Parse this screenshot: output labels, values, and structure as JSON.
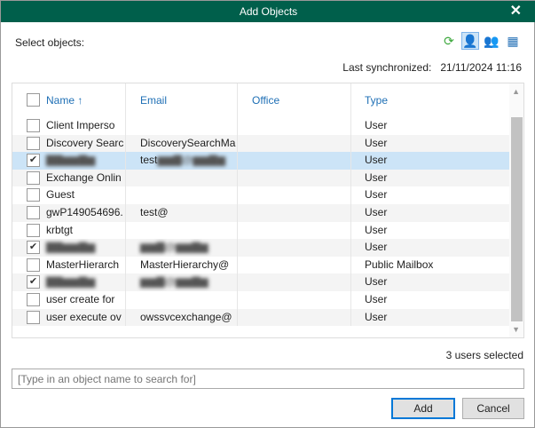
{
  "title": "Add Objects",
  "select_label": "Select objects:",
  "toolbar": {
    "icons": [
      "refresh-icon",
      "user-icon",
      "group-icon",
      "building-icon"
    ]
  },
  "sync": {
    "label": "Last synchronized:",
    "value": "21/11/2024 11:16"
  },
  "columns": [
    "Name ↑",
    "Email",
    "Office",
    "Type"
  ],
  "rows": [
    {
      "name": "Client Imperso",
      "email": "",
      "office": "",
      "type": "User",
      "checked": false
    },
    {
      "name": "Discovery Searc",
      "email": "DiscoverySearchMa",
      "office": "",
      "type": "User",
      "checked": false
    },
    {
      "name": "",
      "email": "test",
      "office": "",
      "type": "User",
      "checked": true,
      "highlight": true,
      "blurred": true
    },
    {
      "name": "Exchange Onlin",
      "email": "",
      "office": "",
      "type": "User",
      "checked": false
    },
    {
      "name": "Guest",
      "email": "",
      "office": "",
      "type": "User",
      "checked": false
    },
    {
      "name": "gwP149054696.",
      "email": "test@",
      "office": "",
      "type": "User",
      "checked": false
    },
    {
      "name": "krbtgt",
      "email": "",
      "office": "",
      "type": "User",
      "checked": false
    },
    {
      "name": "",
      "email": "",
      "office": "",
      "type": "User",
      "checked": true,
      "blurred": true
    },
    {
      "name": "MasterHierarch",
      "email": "MasterHierarchy@",
      "office": "",
      "type": "Public Mailbox",
      "checked": false
    },
    {
      "name": "",
      "email": "",
      "office": "",
      "type": "User",
      "checked": true,
      "blurred": true
    },
    {
      "name": "user create for",
      "email": "",
      "office": "",
      "type": "User",
      "checked": false
    },
    {
      "name": "user execute ov",
      "email": "owssvcexchange@",
      "office": "",
      "type": "User",
      "checked": false
    }
  ],
  "selected_count": "3 users selected",
  "search": {
    "placeholder": "[Type in an object name to search for]",
    "value": ""
  },
  "buttons": {
    "add": "Add",
    "cancel": "Cancel"
  }
}
